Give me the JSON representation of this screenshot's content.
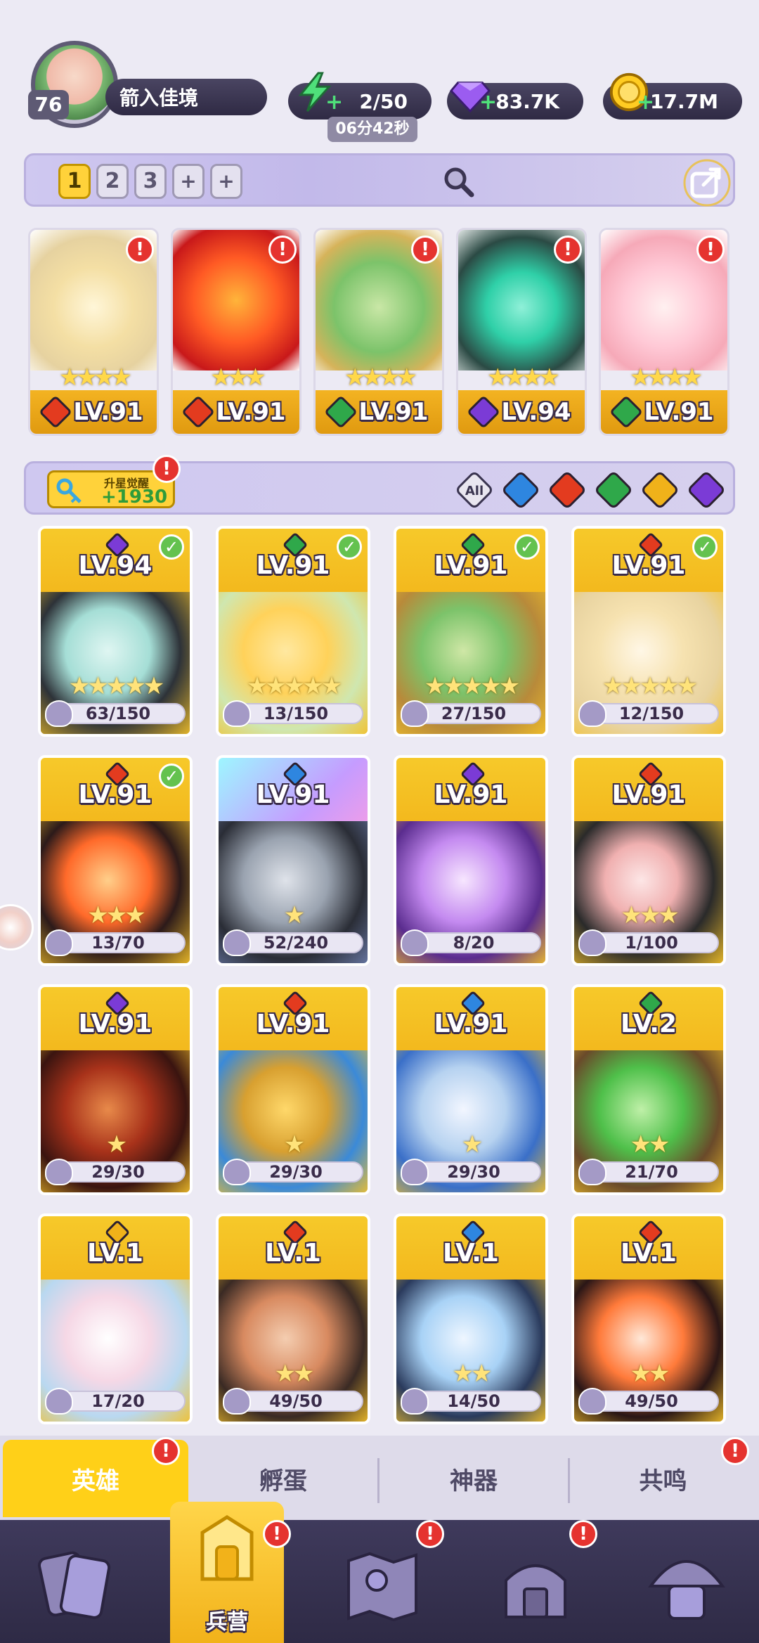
{
  "player": {
    "level": "76",
    "name": "箭入佳境"
  },
  "resources": {
    "energy": "2/50",
    "energy_timer": "06分42秒",
    "gems": "83.7K",
    "gold": "17.7M"
  },
  "team_tabs": [
    "1",
    "2",
    "3",
    "+",
    "+"
  ],
  "team_cards": [
    {
      "level": "LV.91",
      "element": "fire",
      "stars": "★★★★",
      "alert": "!"
    },
    {
      "level": "LV.91",
      "element": "fire",
      "stars": "★★★",
      "alert": "!"
    },
    {
      "level": "LV.91",
      "element": "nature",
      "stars": "★★★★",
      "alert": "!"
    },
    {
      "level": "LV.94",
      "element": "dark",
      "stars": "★★★★",
      "alert": "!"
    },
    {
      "level": "LV.91",
      "element": "nature",
      "stars": "★★★★",
      "alert": "!"
    }
  ],
  "upgrade": {
    "label": "升星觉醒",
    "value": "+1930",
    "alert": "!"
  },
  "filters": [
    "All"
  ],
  "colors": {
    "fire": "#e33b1f",
    "nature": "#2fa84a",
    "dark": "#7b3bd6",
    "water": "#2e86e0",
    "light": "#f0b21a"
  },
  "heroes": [
    {
      "level": "LV.94",
      "progress": "63/150",
      "element": "dark",
      "check": "✓",
      "stars": "★★★★★"
    },
    {
      "level": "LV.91",
      "progress": "13/150",
      "element": "nature",
      "check": "✓",
      "stars": "★★★★★"
    },
    {
      "level": "LV.91",
      "progress": "27/150",
      "element": "nature",
      "check": "✓",
      "stars": "★★★★★"
    },
    {
      "level": "LV.91",
      "progress": "12/150",
      "element": "fire",
      "check": "✓",
      "stars": "★★★★★"
    },
    {
      "level": "LV.91",
      "progress": "13/70",
      "element": "fire",
      "check": "✓",
      "stars": "★★★"
    },
    {
      "level": "LV.91",
      "progress": "52/240",
      "element": "water",
      "check": "",
      "stars": "★"
    },
    {
      "level": "LV.91",
      "progress": "8/20",
      "element": "dark",
      "check": "",
      "stars": ""
    },
    {
      "level": "LV.91",
      "progress": "1/100",
      "element": "fire",
      "check": "",
      "stars": "★★★"
    },
    {
      "level": "LV.91",
      "progress": "29/30",
      "element": "dark",
      "check": "",
      "stars": "★"
    },
    {
      "level": "LV.91",
      "progress": "29/30",
      "element": "fire",
      "check": "",
      "stars": "★"
    },
    {
      "level": "LV.91",
      "progress": "29/30",
      "element": "water",
      "check": "",
      "stars": "★"
    },
    {
      "level": "LV.2",
      "progress": "21/70",
      "element": "nature",
      "check": "",
      "stars": "★★"
    },
    {
      "level": "LV.1",
      "progress": "17/20",
      "element": "light",
      "check": "",
      "stars": ""
    },
    {
      "level": "LV.1",
      "progress": "49/50",
      "element": "fire",
      "check": "",
      "stars": "★★"
    },
    {
      "level": "LV.1",
      "progress": "14/50",
      "element": "water",
      "check": "",
      "stars": "★★"
    },
    {
      "level": "LV.1",
      "progress": "49/50",
      "element": "fire",
      "check": "",
      "stars": "★★"
    }
  ],
  "tabs": {
    "hero": "英雄",
    "egg": "孵蛋",
    "artifact": "神器",
    "resonance": "共鸣"
  },
  "nav": {
    "barracks": "兵营"
  },
  "alert": "!"
}
